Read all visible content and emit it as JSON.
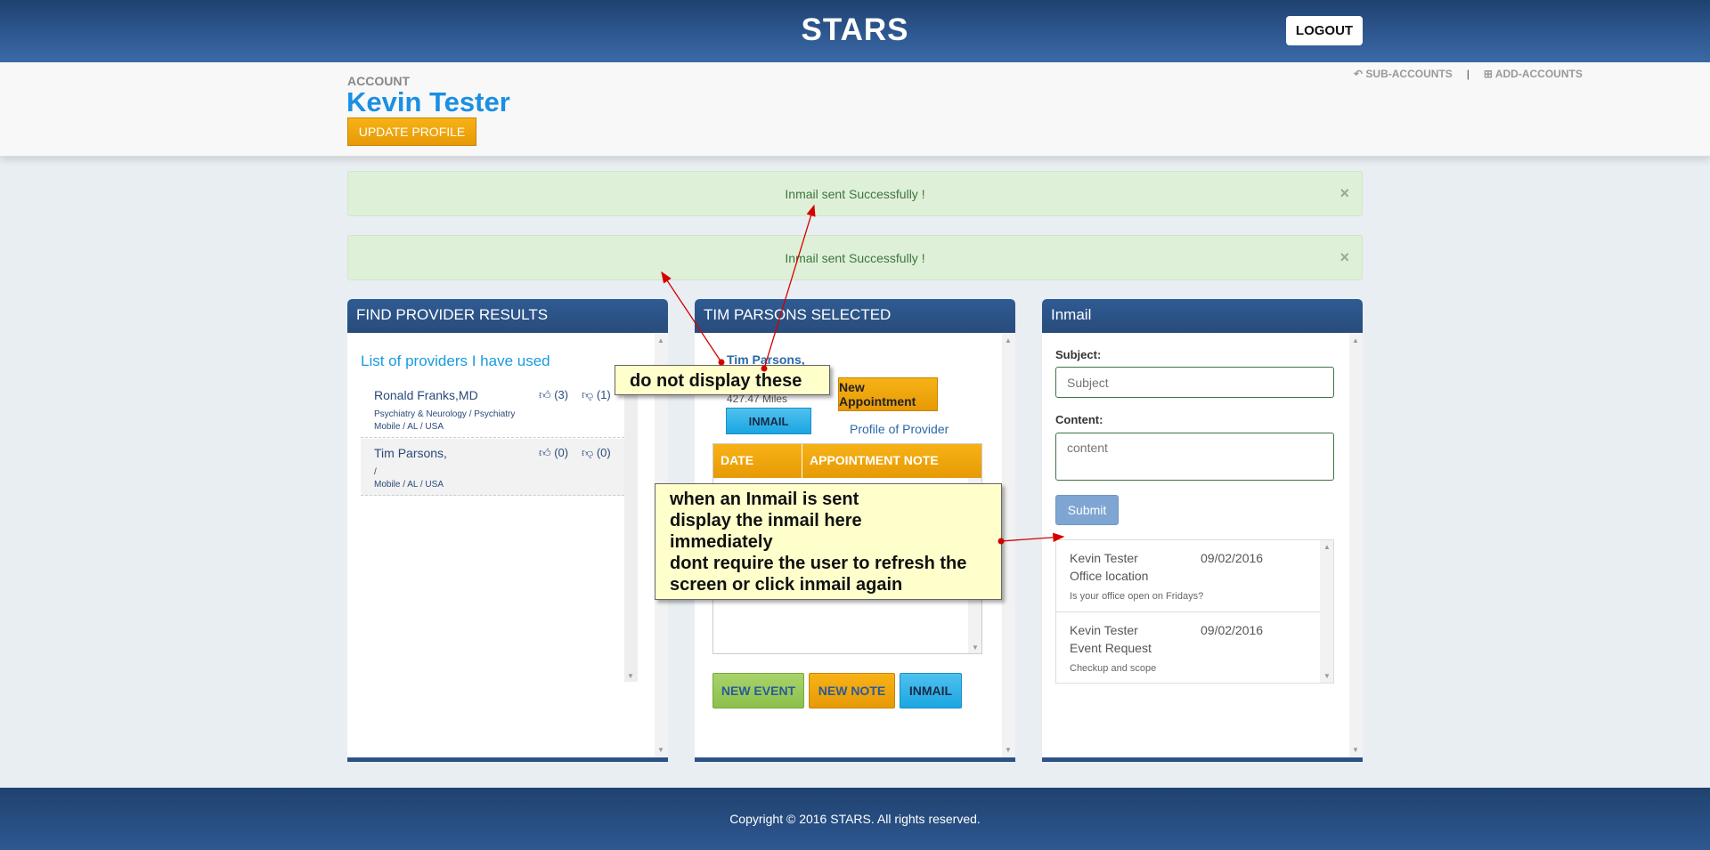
{
  "header": {
    "brand": "STARS",
    "logout_label": "LOGOUT"
  },
  "account": {
    "label": "ACCOUNT",
    "name": "Kevin Tester",
    "update_label": "UPDATE PROFILE",
    "links": {
      "sub_accounts": "SUB-ACCOUNTS",
      "separator": "|",
      "add_accounts": "ADD-ACCOUNTS"
    }
  },
  "alerts": [
    {
      "text": "Inmail sent Successfully !",
      "close": "×"
    },
    {
      "text": "Inmail sent Successfully !",
      "close": "×"
    }
  ],
  "find_provider": {
    "title": "FIND PROVIDER RESULTS",
    "list_title": "List of providers I have used",
    "providers": [
      {
        "name": "Ronald Franks,MD",
        "specialty": "Psychiatry & Neurology / Psychiatry",
        "location": "Mobile / AL / USA",
        "up": "(3)",
        "down": "(1)"
      },
      {
        "name": "Tim Parsons,",
        "specialty": "/",
        "location": "Mobile / AL / USA",
        "up": "(0)",
        "down": "(0)"
      }
    ]
  },
  "selected": {
    "title": "TIM PARSONS SELECTED",
    "name": "Tim Parsons,",
    "miles": "427.47 Miles",
    "inmail_label": "INMAIL",
    "new_appointment_label": "New Appointment",
    "profile_link": "Profile of Provider",
    "table_headers": [
      "DATE",
      "APPOINTMENT NOTE"
    ],
    "buttons": {
      "new_event": "NEW EVENT",
      "new_note": "NEW NOTE",
      "inmail": "INMAIL"
    }
  },
  "inmail": {
    "title": "Inmail",
    "subject_label": "Subject:",
    "subject_placeholder": "Subject",
    "content_label": "Content:",
    "content_placeholder": "content",
    "submit_label": "Submit",
    "messages": [
      {
        "from": "Kevin Tester",
        "date": "09/02/2016",
        "subject": "Office location",
        "body": "Is your office open on Fridays?"
      },
      {
        "from": "Kevin Tester",
        "date": "09/02/2016",
        "subject": "Event Request",
        "body": "Checkup and scope"
      }
    ]
  },
  "annotations": {
    "note1": "do not display these",
    "note2_lines": [
      "when an Inmail is sent",
      "display the inmail here",
      "immediately",
      "dont require the user to refresh the",
      "screen or click inmail again"
    ]
  },
  "footer": {
    "copyright": "Copyright © 2016 STARS. All rights reserved."
  },
  "colors": {
    "header_blue": "#2e5891",
    "accent_orange": "#e79a06",
    "accent_cyan": "#1ba6e2",
    "success_bg": "#dff0d8",
    "annotation_yellow": "#ffffcc",
    "arrow_red": "#d40000"
  }
}
